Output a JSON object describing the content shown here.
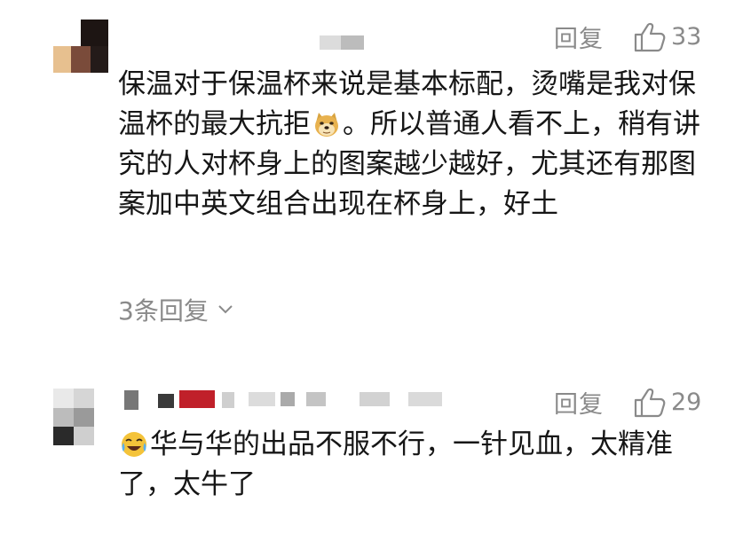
{
  "comments": [
    {
      "reply_label": "回复",
      "like_count": "33",
      "text_before_emoji": "保温对于保温杯来说是基本标配，烫嘴是我对保温杯的最大抗拒",
      "emoji_icon": "doge-emoji",
      "text_after_emoji": "。所以普通人看不上，稍有讲究的人对杯身上的图案越少越好，尤其还有那图案加中英文组合出现在杯身上，好土",
      "replies_label": "3条回复"
    },
    {
      "reply_label": "回复",
      "like_count": "29",
      "emoji_icon": "tears-of-joy-emoji",
      "text_after_emoji": "华与华的出品不服不行，一针见血，太精准了，太牛了"
    }
  ],
  "colors": {
    "meta_gray": "#8a8a8a",
    "text": "#161616",
    "mosaic_red": "#c0202a"
  }
}
